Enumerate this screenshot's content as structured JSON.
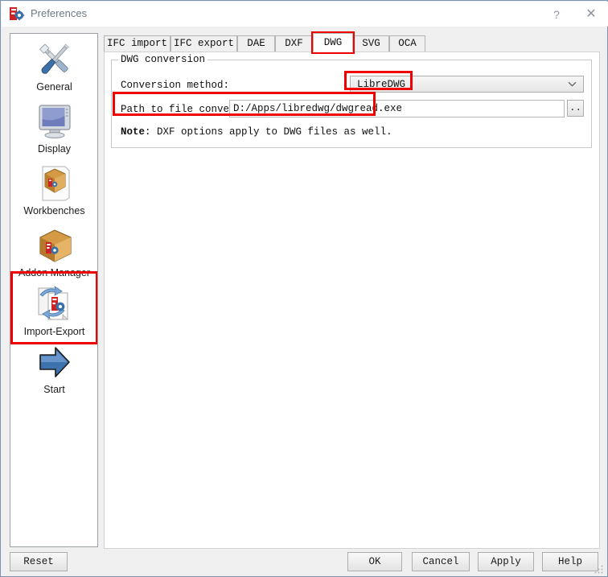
{
  "window": {
    "title": "Preferences",
    "icon": "freecad-icon",
    "help_button": "?",
    "close_button": "✕",
    "accent_highlight_color": "#ee0000",
    "border_color": "#7d93b2"
  },
  "sidebar": {
    "items": [
      {
        "label": "General",
        "icon": "tools-icon",
        "selected": false
      },
      {
        "label": "Display",
        "icon": "monitor-icon",
        "selected": false
      },
      {
        "label": "Workbenches",
        "icon": "workbench-box-icon",
        "selected": false
      },
      {
        "label": "Addon Manager",
        "icon": "addon-box-icon",
        "selected": false
      },
      {
        "label": "Import-Export",
        "icon": "import-export-icon",
        "selected": true
      },
      {
        "label": "Start",
        "icon": "blue-arrow-icon",
        "selected": false
      }
    ]
  },
  "tabs": [
    {
      "label": "IFC import",
      "selected": false,
      "highlighted": false
    },
    {
      "label": "IFC export",
      "selected": false,
      "highlighted": false
    },
    {
      "label": "DAE",
      "selected": false,
      "highlighted": false
    },
    {
      "label": "DXF",
      "selected": false,
      "highlighted": false
    },
    {
      "label": "DWG",
      "selected": true,
      "highlighted": true
    },
    {
      "label": "SVG",
      "selected": false,
      "highlighted": false
    },
    {
      "label": "OCA",
      "selected": false,
      "highlighted": false
    }
  ],
  "panel": {
    "group_title": "DWG conversion",
    "conversion_method_label": "Conversion method:",
    "conversion_method_value": "LibreDWG",
    "path_label": "Path to file converter",
    "path_value": "D:/Apps/libredwg/dwgread.exe",
    "path_placeholder": "",
    "browse_label": "..",
    "note_prefix": "Note",
    "note_text": ": DXF options apply to DWG files as well."
  },
  "footer": {
    "reset": "Reset",
    "ok": "OK",
    "cancel": "Cancel",
    "apply": "Apply",
    "help": "Help"
  }
}
